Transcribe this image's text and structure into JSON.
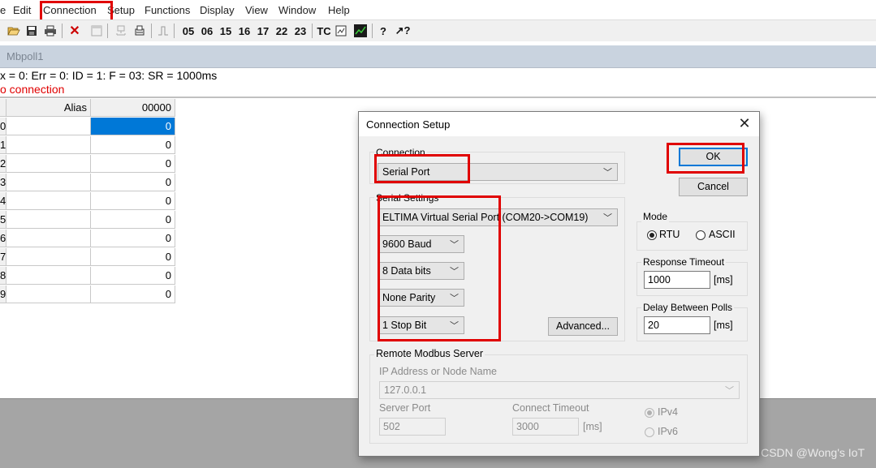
{
  "menu": [
    "e",
    "Edit",
    "Connection",
    "Setup",
    "Functions",
    "Display",
    "View",
    "Window",
    "Help"
  ],
  "toolbar": {
    "fc_buttons": [
      "05",
      "06",
      "15",
      "16",
      "17",
      "22",
      "23"
    ],
    "tc_label": "TC",
    "help_icon": "?",
    "context_help_icon": "↗?"
  },
  "child": {
    "title": "Mbpoll1",
    "status_line": "x = 0: Err = 0: ID = 1: F = 03: SR = 1000ms",
    "error_line": "o connection"
  },
  "grid": {
    "headers": [
      "Alias",
      "00000"
    ],
    "rows": [
      {
        "n": "0",
        "alias": "",
        "value": "0"
      },
      {
        "n": "1",
        "alias": "",
        "value": "0"
      },
      {
        "n": "2",
        "alias": "",
        "value": "0"
      },
      {
        "n": "3",
        "alias": "",
        "value": "0"
      },
      {
        "n": "4",
        "alias": "",
        "value": "0"
      },
      {
        "n": "5",
        "alias": "",
        "value": "0"
      },
      {
        "n": "6",
        "alias": "",
        "value": "0"
      },
      {
        "n": "7",
        "alias": "",
        "value": "0"
      },
      {
        "n": "8",
        "alias": "",
        "value": "0"
      },
      {
        "n": "9",
        "alias": "",
        "value": "0"
      }
    ]
  },
  "dialog": {
    "title": "Connection Setup",
    "close": "✕",
    "connection_label": "Connection",
    "connection_value": "Serial Port",
    "serial_settings_label": "Serial Settings",
    "port": "ELTIMA Virtual Serial Port (COM20->COM19)",
    "baud": "9600 Baud",
    "data_bits": "8 Data bits",
    "parity": "None Parity",
    "stop_bits": "1 Stop Bit",
    "advanced": "Advanced...",
    "ok": "OK",
    "cancel": "Cancel",
    "mode_label": "Mode",
    "mode_rtu": "RTU",
    "mode_ascii": "ASCII",
    "response_timeout_label": "Response Timeout",
    "response_timeout": "1000",
    "ms_unit": "[ms]",
    "delay_label": "Delay Between Polls",
    "delay": "20",
    "remote_label": "Remote Modbus Server",
    "ip_label": "IP Address or Node Name",
    "ip_value": "127.0.0.1",
    "server_port_label": "Server Port",
    "server_port": "502",
    "connect_timeout_label": "Connect Timeout",
    "connect_timeout": "3000",
    "ipv4": "IPv4",
    "ipv6": "IPv6"
  },
  "watermark": "CSDN @Wong's IoT",
  "colors": {
    "highlight": "#e00000",
    "selection": "#0078d7"
  }
}
